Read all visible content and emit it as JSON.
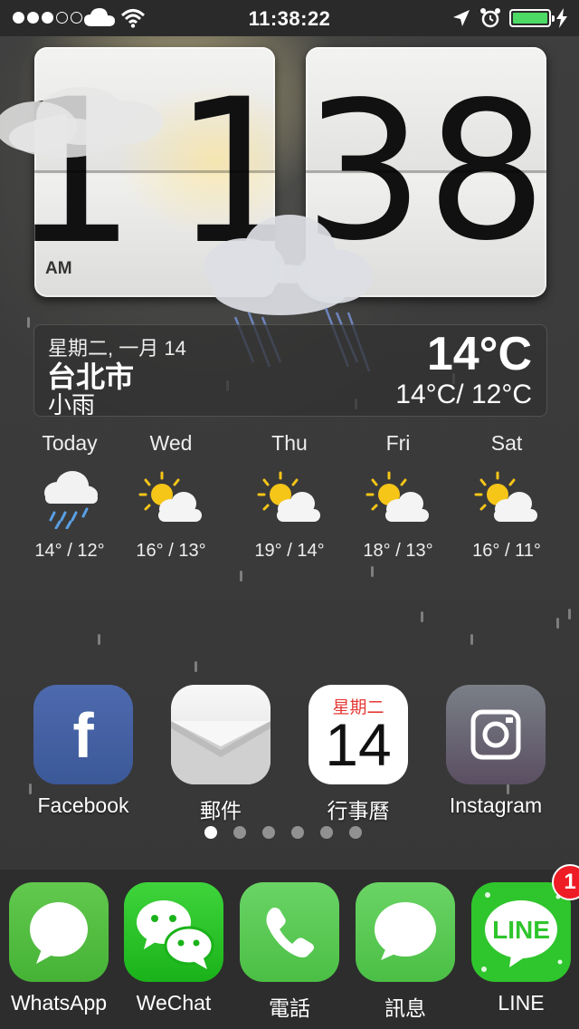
{
  "status_bar": {
    "signal_bars_filled": 3,
    "signal_bars_total": 5,
    "time": "11:38:22",
    "battery_level": 1.0,
    "icons": [
      "cloud-icon",
      "wifi-icon",
      "location-arrow-icon",
      "alarm-clock-icon",
      "charging-bolt-icon"
    ]
  },
  "clock": {
    "hours": "11",
    "minutes": "38",
    "ampm": "AM"
  },
  "weather": {
    "date": "星期二, 一月 14",
    "city": "台北市",
    "condition": "小雨",
    "current_temp": "14°C",
    "range": "14°C/ 12°C"
  },
  "forecast": [
    {
      "day": "Today",
      "temps": "14° / 12°",
      "icon": "rain-cloud-icon"
    },
    {
      "day": "Wed",
      "temps": "16° / 13°",
      "icon": "partly-sunny-icon"
    },
    {
      "day": "Thu",
      "temps": "19° / 14°",
      "icon": "partly-sunny-icon"
    },
    {
      "day": "Fri",
      "temps": "18° / 13°",
      "icon": "partly-sunny-icon"
    },
    {
      "day": "Sat",
      "temps": "16° / 11°",
      "icon": "partly-sunny-icon"
    }
  ],
  "apps": [
    {
      "label": "Facebook",
      "icon": "facebook-icon"
    },
    {
      "label": "郵件",
      "icon": "mail-icon"
    },
    {
      "label": "行事曆",
      "icon": "calendar-icon",
      "weekday": "星期二",
      "day": "14"
    },
    {
      "label": "Instagram",
      "icon": "instagram-icon"
    }
  ],
  "page_indicator": {
    "count": 6,
    "active": 0
  },
  "dock": [
    {
      "label": "WhatsApp",
      "icon": "whatsapp-icon"
    },
    {
      "label": "WeChat",
      "icon": "wechat-icon"
    },
    {
      "label": "電話",
      "icon": "phone-icon"
    },
    {
      "label": "訊息",
      "icon": "messages-icon"
    },
    {
      "label": "LINE",
      "icon": "line-icon",
      "badge": "1",
      "icon_text": "LINE"
    }
  ],
  "colors": {
    "battery": "#4cd964",
    "badge": "#ee1c24",
    "calendar_weekday": "#e53935",
    "facebook": "#3b5897",
    "line": "#2fc52d"
  }
}
